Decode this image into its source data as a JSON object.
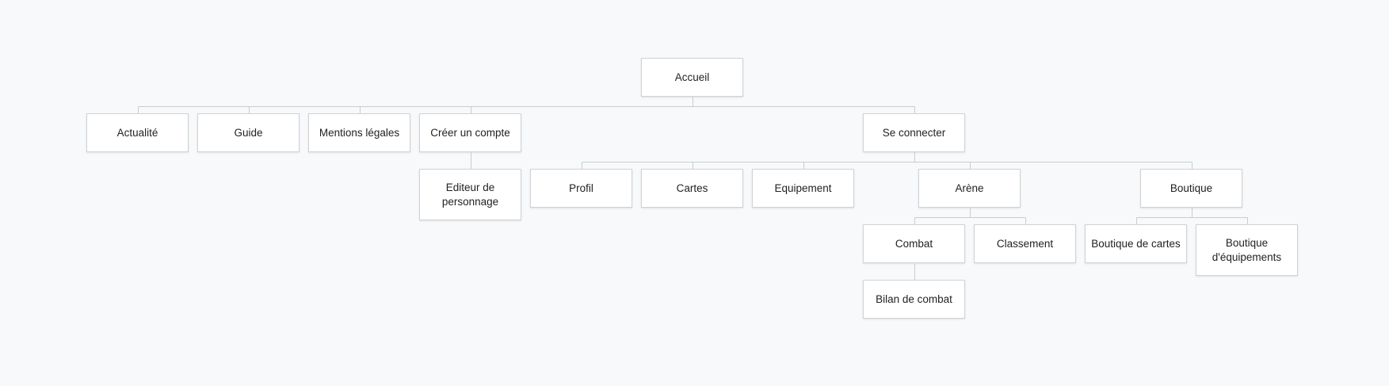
{
  "sitemap": {
    "colors": {
      "background": "#f8f9fa",
      "node_border": "#cfd3d7",
      "connector": "#c9cdd1",
      "text": "#222222"
    },
    "nodes": [
      {
        "id": "accueil",
        "label": "Accueil"
      },
      {
        "id": "actualite",
        "label": "Actualité",
        "parent": "accueil"
      },
      {
        "id": "guide",
        "label": "Guide",
        "parent": "accueil"
      },
      {
        "id": "mentions",
        "label": "Mentions légales",
        "parent": "accueil"
      },
      {
        "id": "creer",
        "label": "Créer un compte",
        "parent": "accueil"
      },
      {
        "id": "connecter",
        "label": "Se connecter",
        "parent": "accueil"
      },
      {
        "id": "editeur",
        "label": "Editeur de personnage",
        "parent": "creer"
      },
      {
        "id": "profil",
        "label": "Profil",
        "parent": "connecter"
      },
      {
        "id": "cartes",
        "label": "Cartes",
        "parent": "connecter"
      },
      {
        "id": "equipement",
        "label": "Equipement",
        "parent": "connecter"
      },
      {
        "id": "arene",
        "label": "Arène",
        "parent": "connecter"
      },
      {
        "id": "boutique",
        "label": "Boutique",
        "parent": "connecter"
      },
      {
        "id": "combat",
        "label": "Combat",
        "parent": "arene"
      },
      {
        "id": "classement",
        "label": "Classement",
        "parent": "arene"
      },
      {
        "id": "bilan",
        "label": "Bilan de combat",
        "parent": "combat"
      },
      {
        "id": "boutique_cartes",
        "label": "Boutique de cartes",
        "parent": "boutique"
      },
      {
        "id": "boutique_equip",
        "label": "Boutique d'équipements",
        "parent": "boutique"
      }
    ]
  }
}
